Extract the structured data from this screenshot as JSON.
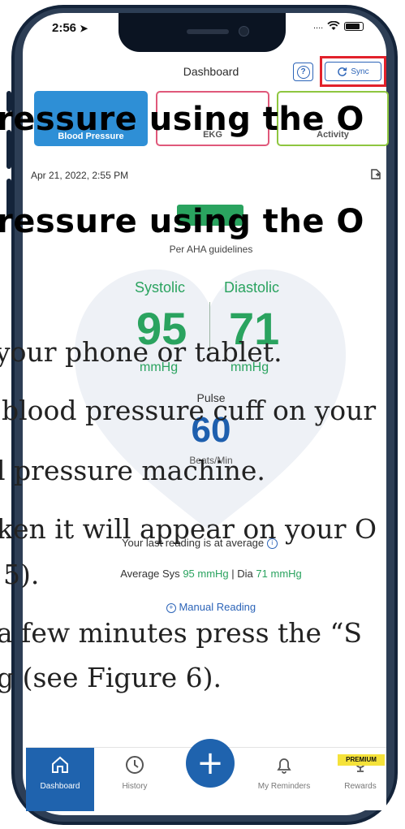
{
  "status_bar": {
    "time": "2:56",
    "signal": "....",
    "wifi_icon": "wifi-icon",
    "battery_icon": "battery-icon"
  },
  "header": {
    "title": "Dashboard",
    "help_label": "?",
    "sync_label": "Sync",
    "highlight_color": "#e2212b"
  },
  "tabs": [
    {
      "label": "Blood Pressure",
      "color": "#2e8fd6",
      "active": true
    },
    {
      "label": "EKG",
      "color": "#e0587a",
      "active": false
    },
    {
      "label": "Activity",
      "color": "#8ec63f",
      "active": false
    }
  ],
  "overlay": {
    "heading_1": "ressure using the O",
    "heading_2": "ressure using the O",
    "lines": [
      "your phone or tablet.",
      "blood pressure cuff on your",
      "l pressure machine.",
      "ken it will appear on your O",
      "5).",
      "a few minutes press the “S",
      "g (see Figure 6)."
    ]
  },
  "reading": {
    "date": "Apr 21, 2022, 2:55 PM",
    "aha_text": "Per AHA guidelines",
    "systolic_label": "Systolic",
    "diastolic_label": "Diastolic",
    "systolic_value": "95",
    "diastolic_value": "71",
    "systolic_unit": "mmHg",
    "diastolic_unit": "mmHg",
    "pulse_label": "Pulse",
    "pulse_value": "60",
    "pulse_unit": "Beats/Min",
    "status_color": "#2aa35f"
  },
  "summary": {
    "last_reading": "Your last reading is at average",
    "average_prefix": "Average Sys",
    "average_sys": "95 mmHg",
    "average_sep": "| Dia",
    "average_dia": "71 mmHg",
    "manual_reading": "Manual Reading"
  },
  "nav": {
    "items": [
      {
        "label": "Dashboard",
        "icon": "home-icon"
      },
      {
        "label": "History",
        "icon": "clock-icon"
      },
      {
        "label": "My Reminders",
        "icon": "bell-icon"
      },
      {
        "label": "Rewards",
        "icon": "trophy-icon"
      }
    ],
    "add_label": "+",
    "premium_label": "PREMIUM",
    "accent_color": "#1f63ae"
  }
}
